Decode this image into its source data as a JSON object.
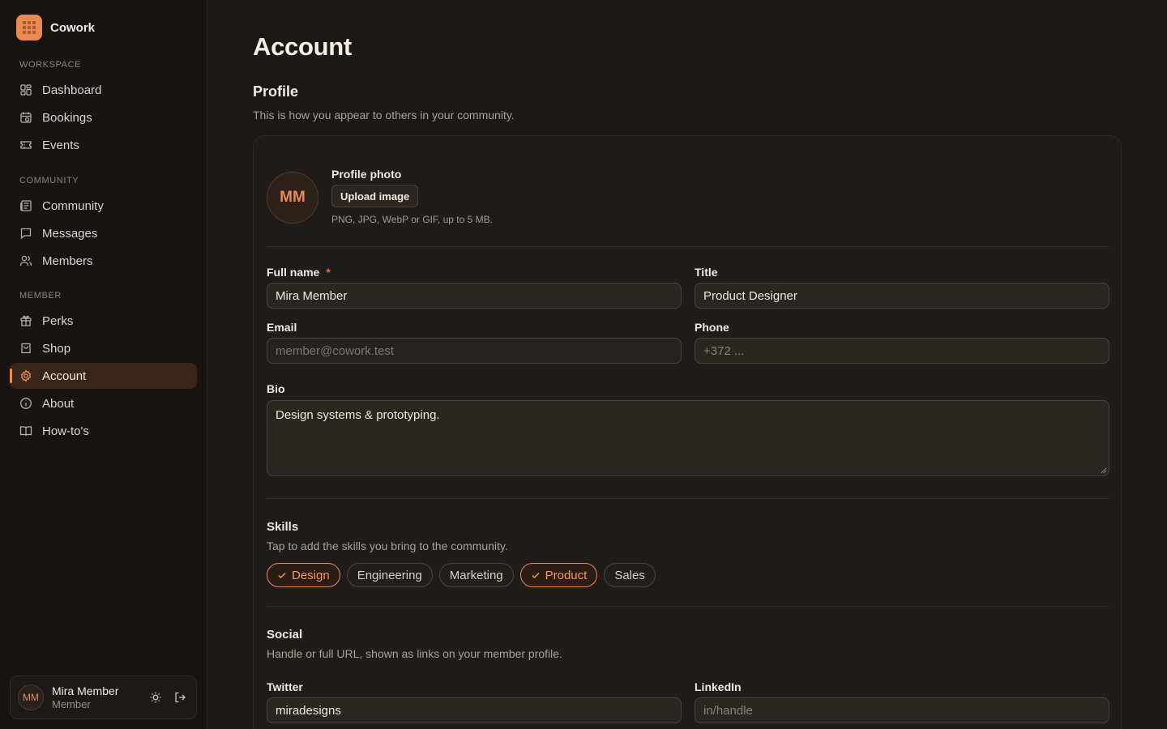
{
  "app": {
    "name": "Cowork"
  },
  "sidebar": {
    "sections": [
      {
        "heading": "WORKSPACE",
        "items": [
          {
            "label": "Dashboard",
            "icon": "dashboard-icon"
          },
          {
            "label": "Bookings",
            "icon": "calendar-icon"
          },
          {
            "label": "Events",
            "icon": "ticket-icon"
          }
        ]
      },
      {
        "heading": "COMMUNITY",
        "items": [
          {
            "label": "Community",
            "icon": "newspaper-icon"
          },
          {
            "label": "Messages",
            "icon": "message-icon"
          },
          {
            "label": "Members",
            "icon": "users-icon"
          }
        ]
      },
      {
        "heading": "MEMBER",
        "items": [
          {
            "label": "Perks",
            "icon": "gift-icon"
          },
          {
            "label": "Shop",
            "icon": "bag-icon"
          },
          {
            "label": "Account",
            "icon": "gear-icon",
            "active": true
          },
          {
            "label": "About",
            "icon": "info-icon"
          },
          {
            "label": "How-to's",
            "icon": "book-icon"
          }
        ]
      }
    ],
    "user": {
      "initials": "MM",
      "name": "Mira Member",
      "role": "Member"
    }
  },
  "page": {
    "title": "Account",
    "profile": {
      "title": "Profile",
      "subtitle": "This is how you appear to others in your community.",
      "photo_label": "Profile photo",
      "upload_label": "Upload image",
      "photo_hint": "PNG, JPG, WebP or GIF, up to 5 MB.",
      "initials": "MM"
    },
    "fields": {
      "full_name": {
        "label": "Full name",
        "required": "*",
        "value": "Mira Member"
      },
      "title": {
        "label": "Title",
        "value": "Product Designer"
      },
      "email": {
        "label": "Email",
        "value": "member@cowork.test"
      },
      "phone": {
        "label": "Phone",
        "placeholder": "+372 ..."
      },
      "bio": {
        "label": "Bio",
        "value": "Design systems & prototyping."
      }
    },
    "skills": {
      "title": "Skills",
      "subtitle": "Tap to add the skills you bring to the community.",
      "options": [
        {
          "label": "Design",
          "selected": true
        },
        {
          "label": "Engineering",
          "selected": false
        },
        {
          "label": "Marketing",
          "selected": false
        },
        {
          "label": "Product",
          "selected": true
        },
        {
          "label": "Sales",
          "selected": false
        }
      ]
    },
    "social": {
      "title": "Social",
      "subtitle": "Handle or full URL, shown as links on your member profile.",
      "twitter": {
        "label": "Twitter",
        "value": "miradesigns"
      },
      "linkedin": {
        "label": "LinkedIn",
        "placeholder": "in/handle"
      }
    }
  },
  "colors": {
    "accent": "#e98a55",
    "background": "#1c1815",
    "sidebar": "#181411"
  }
}
